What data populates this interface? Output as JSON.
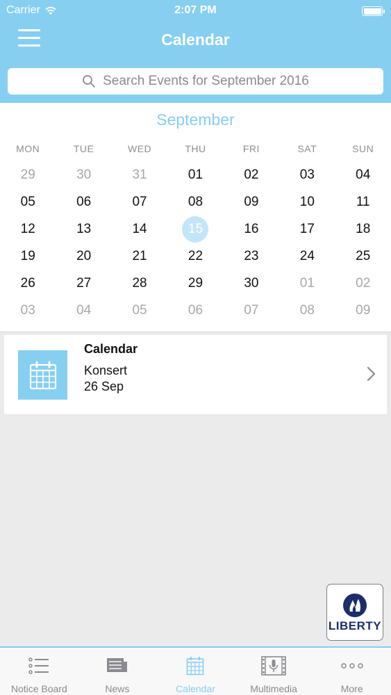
{
  "status_bar": {
    "carrier": "Carrier",
    "time": "2:07 PM"
  },
  "header": {
    "title": "Calendar"
  },
  "search": {
    "placeholder": "Search Events for September 2016"
  },
  "calendar": {
    "month": "September",
    "weekdays": [
      "MON",
      "TUE",
      "WED",
      "THU",
      "FRI",
      "SAT",
      "SUN"
    ],
    "days": [
      {
        "label": "29",
        "muted": true
      },
      {
        "label": "30",
        "muted": true
      },
      {
        "label": "31",
        "muted": true
      },
      {
        "label": "01"
      },
      {
        "label": "02"
      },
      {
        "label": "03"
      },
      {
        "label": "04"
      },
      {
        "label": "05"
      },
      {
        "label": "06"
      },
      {
        "label": "07"
      },
      {
        "label": "08"
      },
      {
        "label": "09"
      },
      {
        "label": "10"
      },
      {
        "label": "11"
      },
      {
        "label": "12"
      },
      {
        "label": "13"
      },
      {
        "label": "14"
      },
      {
        "label": "15",
        "today": true
      },
      {
        "label": "16"
      },
      {
        "label": "17"
      },
      {
        "label": "18"
      },
      {
        "label": "19"
      },
      {
        "label": "20"
      },
      {
        "label": "21"
      },
      {
        "label": "22"
      },
      {
        "label": "23"
      },
      {
        "label": "24"
      },
      {
        "label": "25"
      },
      {
        "label": "26"
      },
      {
        "label": "27"
      },
      {
        "label": "28"
      },
      {
        "label": "29"
      },
      {
        "label": "30"
      },
      {
        "label": "01",
        "muted": true
      },
      {
        "label": "02",
        "muted": true
      },
      {
        "label": "03",
        "muted": true
      },
      {
        "label": "04",
        "muted": true
      },
      {
        "label": "05",
        "muted": true
      },
      {
        "label": "06",
        "muted": true
      },
      {
        "label": "07",
        "muted": true
      },
      {
        "label": "08",
        "muted": true
      },
      {
        "label": "09",
        "muted": true
      }
    ]
  },
  "event": {
    "title": "Calendar",
    "name": "Konsert",
    "date": "26 Sep",
    "icon": "calendar-icon"
  },
  "sponsor": {
    "label": "LIBERTY"
  },
  "tabs": [
    {
      "label": "Notice Board",
      "icon": "list-icon"
    },
    {
      "label": "News",
      "icon": "newspaper-icon"
    },
    {
      "label": "Calendar",
      "icon": "calendar-icon",
      "active": true
    },
    {
      "label": "Multimedia",
      "icon": "film-microphone-icon"
    },
    {
      "label": "More",
      "icon": "more-dots-icon"
    }
  ],
  "colors": {
    "accent": "#86cff0",
    "today_fill": "#c2e6f8",
    "background": "#ebebec",
    "brand_navy": "#1b2e6b"
  }
}
